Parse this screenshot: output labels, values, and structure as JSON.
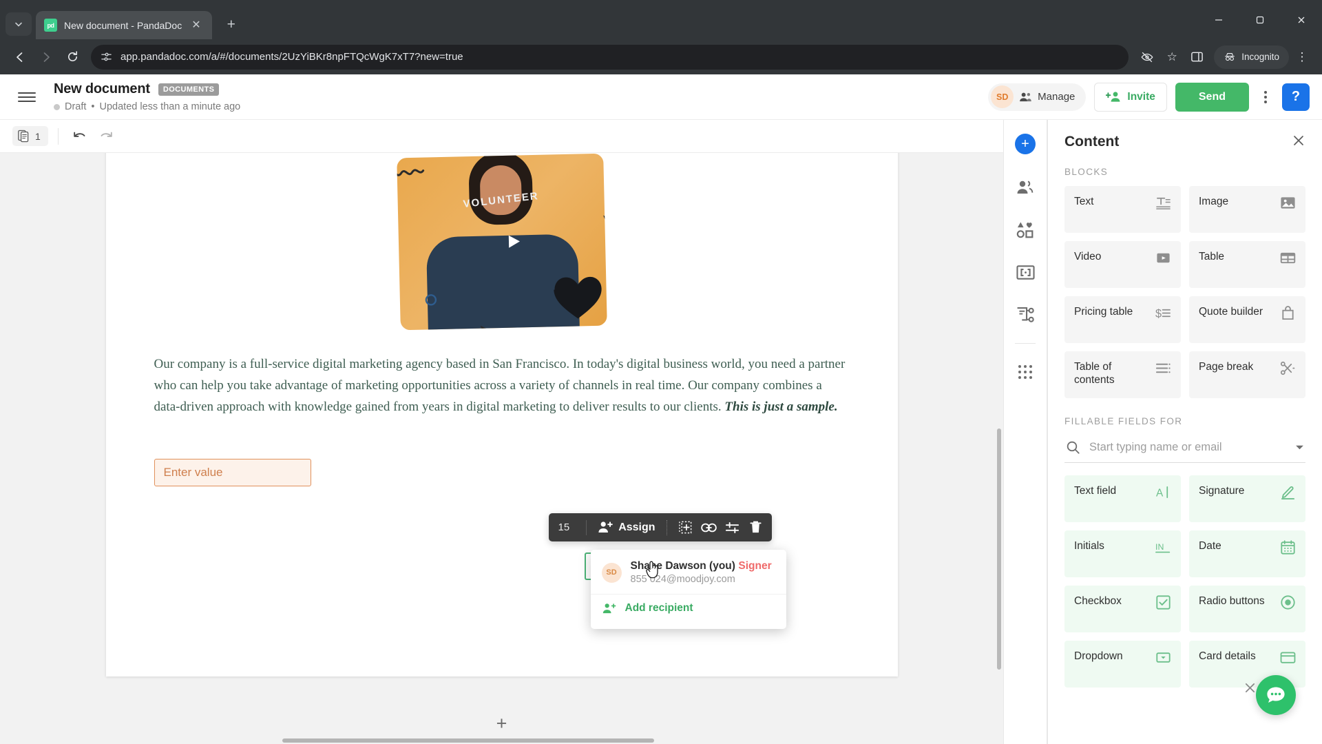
{
  "browser": {
    "tab_title": "New document - PandaDoc",
    "favicon_text": "pd",
    "url": "app.pandadoc.com/a/#/documents/2UzYiBKr8npFTQcWgK7xT7?new=true",
    "incognito_label": "Incognito",
    "icons": {
      "tab_search": "chevron-down-icon",
      "tab_close": "✕",
      "new_tab": "+",
      "back": "←",
      "forward": "→",
      "reload": "↻",
      "minimize": "—",
      "maximize": "☐",
      "close": "✕",
      "bookmark": "☆",
      "menu": "⋮"
    }
  },
  "app_header": {
    "title": "New document",
    "badge": "DOCUMENTS",
    "status": "Draft",
    "separator": "•",
    "updated": "Updated less than a minute ago",
    "avatar_initials": "SD",
    "manage_label": "Manage",
    "invite_label": "Invite",
    "send_label": "Send",
    "help_label": "?"
  },
  "doc_toolbar": {
    "pages_count": "1",
    "undo_label": "undo",
    "redo_label": "redo"
  },
  "document": {
    "image_alt": "VOLUNTEER",
    "shirt_text": "VOLUNTEER",
    "paragraph": "Our company is a full-service digital marketing agency based in San Francisco. In today's digital business world, you need a partner who can help you take advantage of marketing opportunities across a variety of channels in real time. Our company combines a data-driven approach with knowledge gained from years in digital marketing to deliver results to our clients. ",
    "paragraph_bold": "This is just a sample.",
    "field_placeholder": "Enter value",
    "add_page_label": "+"
  },
  "selection_toolbar": {
    "font_size": "15",
    "assign_label": "Assign",
    "icons": [
      "duplicate-field-icon",
      "link-icon",
      "settings-sliders-icon",
      "trash-icon"
    ]
  },
  "recipient_menu": {
    "avatar_initials": "SD",
    "name": "Shane Dawson (you)",
    "role": "Signer",
    "email": "855 024@moodjoy.com",
    "add_recipient_label": "Add recipient"
  },
  "sidebar": {
    "panel_title": "Content",
    "rail_items": [
      "add-content-icon",
      "recipients-icon",
      "content-library-icon",
      "variables-icon",
      "workflow-icon",
      "apps-grid-icon"
    ],
    "blocks_label": "BLOCKS",
    "blocks": [
      {
        "label": "Text",
        "icon": "text-block-icon"
      },
      {
        "label": "Image",
        "icon": "image-block-icon"
      },
      {
        "label": "Video",
        "icon": "video-block-icon"
      },
      {
        "label": "Table",
        "icon": "table-block-icon"
      },
      {
        "label": "Pricing table",
        "icon": "pricing-table-icon"
      },
      {
        "label": "Quote builder",
        "icon": "quote-builder-icon"
      },
      {
        "label": "Table of contents",
        "icon": "table-of-contents-icon"
      },
      {
        "label": "Page break",
        "icon": "page-break-icon"
      }
    ],
    "fillable_label": "FILLABLE FIELDS FOR",
    "search_placeholder": "Start typing name or email",
    "fields": [
      {
        "label": "Text field",
        "icon": "text-field-icon"
      },
      {
        "label": "Signature",
        "icon": "signature-icon"
      },
      {
        "label": "Initials",
        "icon": "initials-icon"
      },
      {
        "label": "Date",
        "icon": "date-icon"
      },
      {
        "label": "Checkbox",
        "icon": "checkbox-icon"
      },
      {
        "label": "Radio buttons",
        "icon": "radio-buttons-icon"
      },
      {
        "label": "Dropdown",
        "icon": "dropdown-icon"
      },
      {
        "label": "Card details",
        "icon": "card-details-icon"
      }
    ]
  },
  "colors": {
    "accent_green": "#44b868",
    "blue": "#1a73e8",
    "field_orange": "#e0905a",
    "signer_red": "#ef6a6a"
  }
}
